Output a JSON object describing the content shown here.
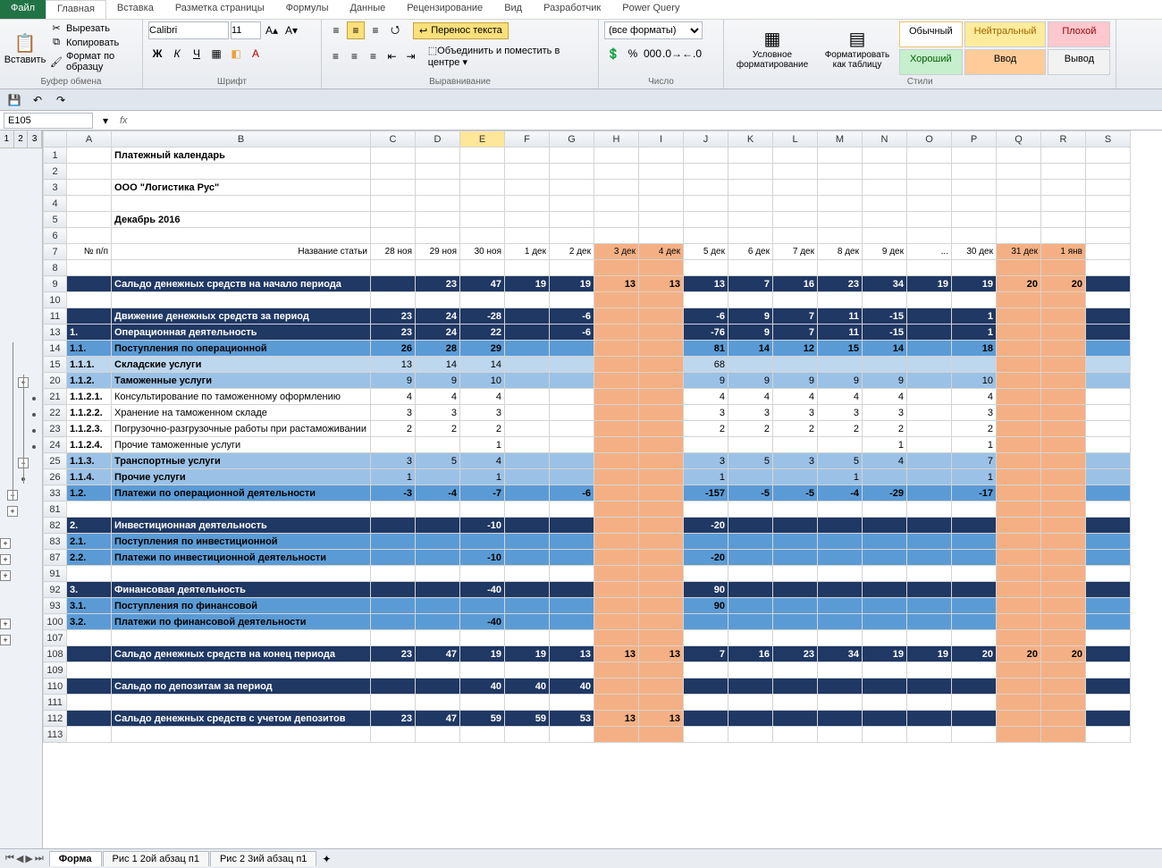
{
  "ribbon": {
    "file": "Файл",
    "tabs": [
      "Главная",
      "Вставка",
      "Разметка страницы",
      "Формулы",
      "Данные",
      "Рецензирование",
      "Вид",
      "Разработчик",
      "Power Query"
    ],
    "clipboard": {
      "label": "Буфер обмена",
      "paste": "Вставить",
      "cut": "Вырезать",
      "copy": "Копировать",
      "format": "Формат по образцу"
    },
    "font": {
      "label": "Шрифт",
      "name": "Calibri",
      "size": "11"
    },
    "align": {
      "label": "Выравнивание",
      "wrap": "Перенос текста",
      "merge": "Объединить и поместить в центре"
    },
    "number": {
      "label": "Число",
      "fmt": "(все форматы)"
    },
    "cond": {
      "label": "Условное форматирование"
    },
    "table": {
      "label": "Форматировать как таблицу"
    },
    "styles": {
      "label": "Стили",
      "normal": "Обычный",
      "neutral": "Нейтральный",
      "bad": "Плохой",
      "good": "Хороший",
      "input": "Ввод",
      "output": "Вывод"
    }
  },
  "namebox": "E105",
  "outline_levels": [
    "1",
    "2",
    "3"
  ],
  "cols": [
    "A",
    "B",
    "C",
    "D",
    "E",
    "F",
    "G",
    "H",
    "I",
    "J",
    "K",
    "L",
    "M",
    "N",
    "O",
    "P",
    "Q",
    "R",
    "S"
  ],
  "sel_col": "E",
  "wk_cols": [
    "H",
    "I",
    "Q",
    "R"
  ],
  "sheet_tabs": {
    "active": "Форма",
    "others": [
      "Рис 1 2ой абзац п1",
      "Рис 2 3ий абзац п1"
    ]
  },
  "titles": {
    "r1": "Платежный календарь",
    "r3": "ООО \"Логистика Рус\"",
    "r5": "Декабрь 2016",
    "r7a": "№ п/п",
    "r7b": "Название статьи"
  },
  "dates": [
    "28 ноя",
    "29 ноя",
    "30 ноя",
    "1 дек",
    "2 дек",
    "3 дек",
    "4 дек",
    "5 дек",
    "6 дек",
    "7 дек",
    "8 дек",
    "9 дек",
    "...",
    "30 дек",
    "31 дек",
    "1 янв"
  ],
  "rows": [
    {
      "n": 9,
      "cls": "navyhdr",
      "a": "",
      "b": "Сальдо денежных средств на начало периода",
      "v": [
        "",
        "23",
        "47",
        "19",
        "19",
        "13",
        "13",
        "13",
        "7",
        "16",
        "23",
        "34",
        "19",
        "19",
        "20",
        "20"
      ]
    },
    {
      "n": 10,
      "cls": "blank"
    },
    {
      "n": 11,
      "cls": "navyhdr",
      "a": "",
      "b": "Движение денежных средств за период",
      "v": [
        "23",
        "24",
        "-28",
        "",
        "-6",
        "",
        "",
        "-6",
        "9",
        "7",
        "11",
        "-15",
        "",
        "1",
        "",
        ""
      ]
    },
    {
      "n": 13,
      "cls": "sec",
      "a": "1.",
      "b": "Операционная деятельность",
      "v": [
        "23",
        "24",
        "22",
        "",
        "-6",
        "",
        "",
        "-76",
        "9",
        "7",
        "11",
        "-15",
        "",
        "1",
        "",
        ""
      ]
    },
    {
      "n": 14,
      "cls": "med",
      "a": "1.1.",
      "b": "Поступления по операционной",
      "v": [
        "26",
        "28",
        "29",
        "",
        "",
        "",
        "",
        "81",
        "14",
        "12",
        "15",
        "14",
        "",
        "18",
        "",
        ""
      ]
    },
    {
      "n": 15,
      "cls": "lighter",
      "a": "1.1.1.",
      "b": "Складские услуги",
      "v": [
        "13",
        "14",
        "14",
        "",
        "",
        "",
        "",
        "68",
        "",
        "",
        "",
        "",
        "",
        "",
        "",
        ""
      ]
    },
    {
      "n": 20,
      "cls": "light",
      "a": "1.1.2.",
      "b": "Таможенные услуги",
      "v": [
        "9",
        "9",
        "10",
        "",
        "",
        "",
        "",
        "9",
        "9",
        "9",
        "9",
        "9",
        "",
        "10",
        "",
        ""
      ]
    },
    {
      "n": 21,
      "cls": "white",
      "a": "1.1.2.1.",
      "b": "Консультирование по таможенному оформлению",
      "v": [
        "4",
        "4",
        "4",
        "",
        "",
        "",
        "",
        "4",
        "4",
        "4",
        "4",
        "4",
        "",
        "4",
        "",
        ""
      ]
    },
    {
      "n": 22,
      "cls": "white",
      "a": "1.1.2.2.",
      "b": "Хранение на таможенном складе",
      "v": [
        "3",
        "3",
        "3",
        "",
        "",
        "",
        "",
        "3",
        "3",
        "3",
        "3",
        "3",
        "",
        "3",
        "",
        ""
      ]
    },
    {
      "n": 23,
      "cls": "white",
      "a": "1.1.2.3.",
      "b": "Погрузочно-разгрузочные работы при растаможивании",
      "v": [
        "2",
        "2",
        "2",
        "",
        "",
        "",
        "",
        "2",
        "2",
        "2",
        "2",
        "2",
        "",
        "2",
        "",
        ""
      ]
    },
    {
      "n": 24,
      "cls": "white",
      "a": "1.1.2.4.",
      "b": "Прочие таможенные услуги",
      "v": [
        "",
        "",
        "1",
        "",
        "",
        "",
        "",
        "",
        "",
        "",
        "",
        "1",
        "",
        "1",
        "",
        ""
      ]
    },
    {
      "n": 25,
      "cls": "light",
      "a": "1.1.3.",
      "b": "Транспортные услуги",
      "v": [
        "3",
        "5",
        "4",
        "",
        "",
        "",
        "",
        "3",
        "5",
        "3",
        "5",
        "4",
        "",
        "7",
        "",
        ""
      ]
    },
    {
      "n": 26,
      "cls": "light",
      "a": "1.1.4.",
      "b": "Прочие услуги",
      "v": [
        "1",
        "",
        "1",
        "",
        "",
        "",
        "",
        "1",
        "",
        "",
        "1",
        "",
        "",
        "1",
        "",
        ""
      ]
    },
    {
      "n": 33,
      "cls": "med",
      "a": "1.2.",
      "b": "Платежи по операционной деятельности",
      "v": [
        "-3",
        "-4",
        "-7",
        "",
        "-6",
        "",
        "",
        "-157",
        "-5",
        "-5",
        "-4",
        "-29",
        "",
        "-17",
        "",
        ""
      ]
    },
    {
      "n": 81,
      "cls": "blank"
    },
    {
      "n": 82,
      "cls": "sec",
      "a": "2.",
      "b": "Инвестиционная деятельность",
      "v": [
        "",
        "",
        "-10",
        "",
        "",
        "",
        "",
        "-20",
        "",
        "",
        "",
        "",
        "",
        "",
        "",
        ""
      ]
    },
    {
      "n": 83,
      "cls": "med",
      "a": "2.1.",
      "b": "Поступления по инвестиционной",
      "v": [
        "",
        "",
        "",
        "",
        "",
        "",
        "",
        "",
        "",
        "",
        "",
        "",
        "",
        "",
        "",
        ""
      ]
    },
    {
      "n": 87,
      "cls": "med",
      "a": "2.2.",
      "b": "Платежи по инвестиционной деятельности",
      "v": [
        "",
        "",
        "-10",
        "",
        "",
        "",
        "",
        "-20",
        "",
        "",
        "",
        "",
        "",
        "",
        "",
        ""
      ]
    },
    {
      "n": 91,
      "cls": "blank"
    },
    {
      "n": 92,
      "cls": "sec",
      "a": "3.",
      "b": "Финансовая деятельность",
      "v": [
        "",
        "",
        "-40",
        "",
        "",
        "",
        "",
        "90",
        "",
        "",
        "",
        "",
        "",
        "",
        "",
        ""
      ]
    },
    {
      "n": 93,
      "cls": "med",
      "a": "3.1.",
      "b": "Поступления по финансовой",
      "v": [
        "",
        "",
        "",
        "",
        "",
        "",
        "",
        "90",
        "",
        "",
        "",
        "",
        "",
        "",
        "",
        ""
      ]
    },
    {
      "n": 100,
      "cls": "med",
      "a": "3.2.",
      "b": "Платежи по финансовой деятельности",
      "v": [
        "",
        "",
        "-40",
        "",
        "",
        "",
        "",
        "",
        "",
        "",
        "",
        "",
        "",
        "",
        "",
        ""
      ]
    },
    {
      "n": 107,
      "cls": "blank"
    },
    {
      "n": 108,
      "cls": "navyhdr",
      "a": "",
      "b": "Сальдо денежных средств на конец периода",
      "v": [
        "23",
        "47",
        "19",
        "19",
        "13",
        "13",
        "13",
        "7",
        "16",
        "23",
        "34",
        "19",
        "19",
        "20",
        "20",
        "20"
      ]
    },
    {
      "n": 109,
      "cls": "blank"
    },
    {
      "n": 110,
      "cls": "navyhdr",
      "a": "",
      "b": "Сальдо по депозитам за период",
      "v": [
        "",
        "",
        "40",
        "40",
        "40",
        "",
        "",
        "",
        "",
        "",
        "",
        "",
        "",
        "",
        "",
        ""
      ]
    },
    {
      "n": 111,
      "cls": "blank"
    },
    {
      "n": 112,
      "cls": "navyhdr",
      "a": "",
      "b": "Сальдо денежных средств с учетом депозитов",
      "v": [
        "23",
        "47",
        "59",
        "59",
        "53",
        "13",
        "13",
        "",
        "",
        "",
        "",
        "",
        "",
        "",
        "",
        ""
      ]
    },
    {
      "n": 113,
      "cls": "blank"
    }
  ]
}
